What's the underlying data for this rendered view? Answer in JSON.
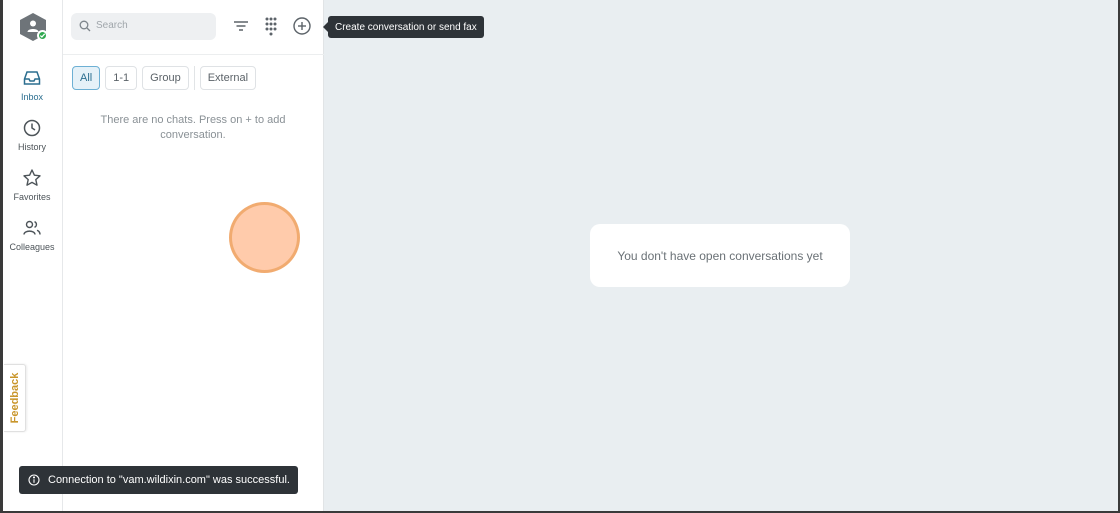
{
  "rail": {
    "items": [
      {
        "label": "Inbox",
        "icon": "inbox-icon",
        "active": true
      },
      {
        "label": "History",
        "icon": "clock-icon",
        "active": false
      },
      {
        "label": "Favorites",
        "icon": "star-icon",
        "active": false
      },
      {
        "label": "Colleagues",
        "icon": "people-icon",
        "active": false
      }
    ],
    "feedback_label": "Feedback"
  },
  "panel": {
    "search_placeholder": "Search",
    "filters": [
      "All",
      "1-1",
      "Group",
      "External"
    ],
    "active_filter": "All",
    "empty_message": "There are no chats. Press on + to add conversation."
  },
  "tooltip": "Create conversation or send fax",
  "main": {
    "empty_message": "You don't have open conversations yet"
  },
  "toast": {
    "message": "Connection to \"vam.wildixin.com\" was successful."
  },
  "colors": {
    "accent": "#2b6e8f",
    "status_online": "#2fa84f",
    "feedback": "#c9962b",
    "main_bg": "#e9eef1"
  }
}
